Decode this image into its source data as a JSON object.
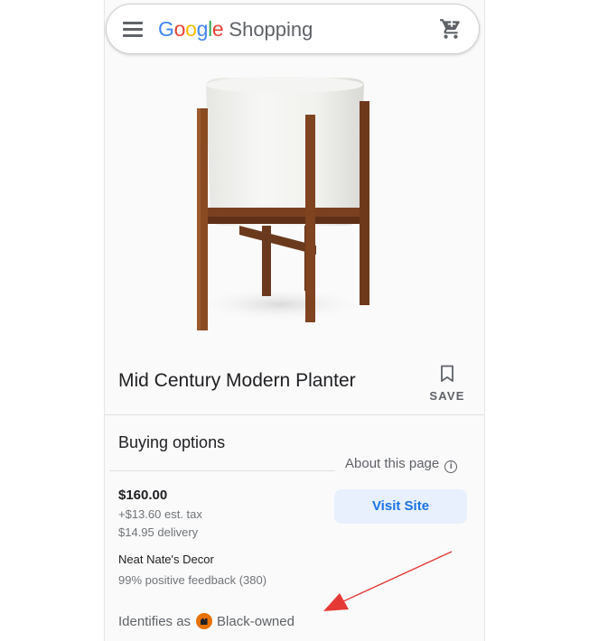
{
  "header": {
    "menu_icon": "hamburger-menu-icon",
    "logo_letters": [
      {
        "char": "G",
        "color": "#4285F4"
      },
      {
        "char": "o",
        "color": "#EA4335"
      },
      {
        "char": "o",
        "color": "#FBBC05"
      },
      {
        "char": "g",
        "color": "#4285F4"
      },
      {
        "char": "l",
        "color": "#34A853"
      },
      {
        "char": "e",
        "color": "#EA4335"
      }
    ],
    "logo_suffix": "Shopping",
    "cart_icon": "shopping-cart-icon"
  },
  "product": {
    "image": "white-planter-on-wooden-stand",
    "title": "Mid Century Modern Planter",
    "save_label": "SAVE",
    "save_icon": "bookmark-icon"
  },
  "buying": {
    "section_title": "Buying options",
    "about_label": "About this page",
    "about_icon": "info-icon",
    "offer": {
      "price": "$160.00",
      "tax": "+$13.60 est. tax",
      "delivery": "$14.95 delivery",
      "visit_label": "Visit Site",
      "seller": "Neat Nate's Decor",
      "feedback": "99% positive feedback (380)"
    },
    "identity_prefix": "Identifies as",
    "identity_label": "Black-owned",
    "identity_icon": "black-owned-badge-icon"
  },
  "colors": {
    "accent_blue": "#1a73e8",
    "button_bg": "#e8f0fe",
    "badge_orange": "#e8710a",
    "annotation_arrow": "#e53935"
  }
}
